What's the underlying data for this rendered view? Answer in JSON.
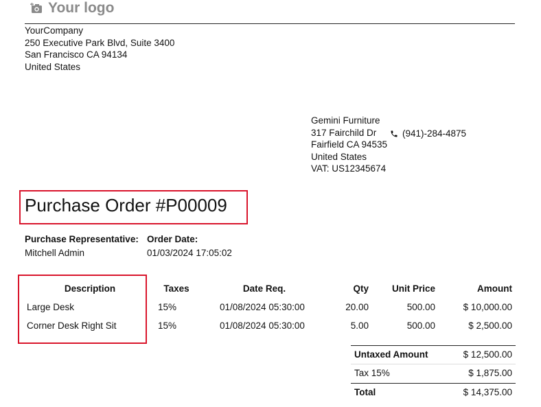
{
  "logo": {
    "text": "Your logo",
    "icon": "camera-plus-icon"
  },
  "company": {
    "name": "YourCompany",
    "street": "250 Executive Park Blvd, Suite 3400",
    "city": "San Francisco CA 94134",
    "country": "United States"
  },
  "vendor": {
    "name": "Gemini Furniture",
    "street": "317 Fairchild Dr",
    "city": "Fairfield CA 94535",
    "country": "United States",
    "vat": "VAT: US12345674",
    "phone": "(941)-284-4875"
  },
  "title": "Purchase Order #P00009",
  "info": {
    "rep_label": "Purchase Representative:",
    "rep_value": "Mitchell Admin",
    "date_label": "Order Date:",
    "date_value": "01/03/2024 17:05:02"
  },
  "table": {
    "headers": {
      "description": "Description",
      "taxes": "Taxes",
      "date": "Date Req.",
      "qty": "Qty",
      "unit_price": "Unit Price",
      "amount": "Amount"
    },
    "rows": [
      {
        "description": "Large Desk",
        "taxes": "15%",
        "date": "01/08/2024 05:30:00",
        "qty": "20.00",
        "unit_price": "500.00",
        "amount": "$ 10,000.00"
      },
      {
        "description": "Corner Desk Right Sit",
        "taxes": "15%",
        "date": "01/08/2024 05:30:00",
        "qty": "5.00",
        "unit_price": "500.00",
        "amount": "$ 2,500.00"
      }
    ]
  },
  "totals": {
    "untaxed_label": "Untaxed Amount",
    "untaxed_value": "$ 12,500.00",
    "tax_label": "Tax 15%",
    "tax_value": "$ 1,875.00",
    "total_label": "Total",
    "total_value": "$ 14,375.00"
  },
  "colors": {
    "highlight": "#d9142b",
    "logo": "#8a8a8a"
  }
}
